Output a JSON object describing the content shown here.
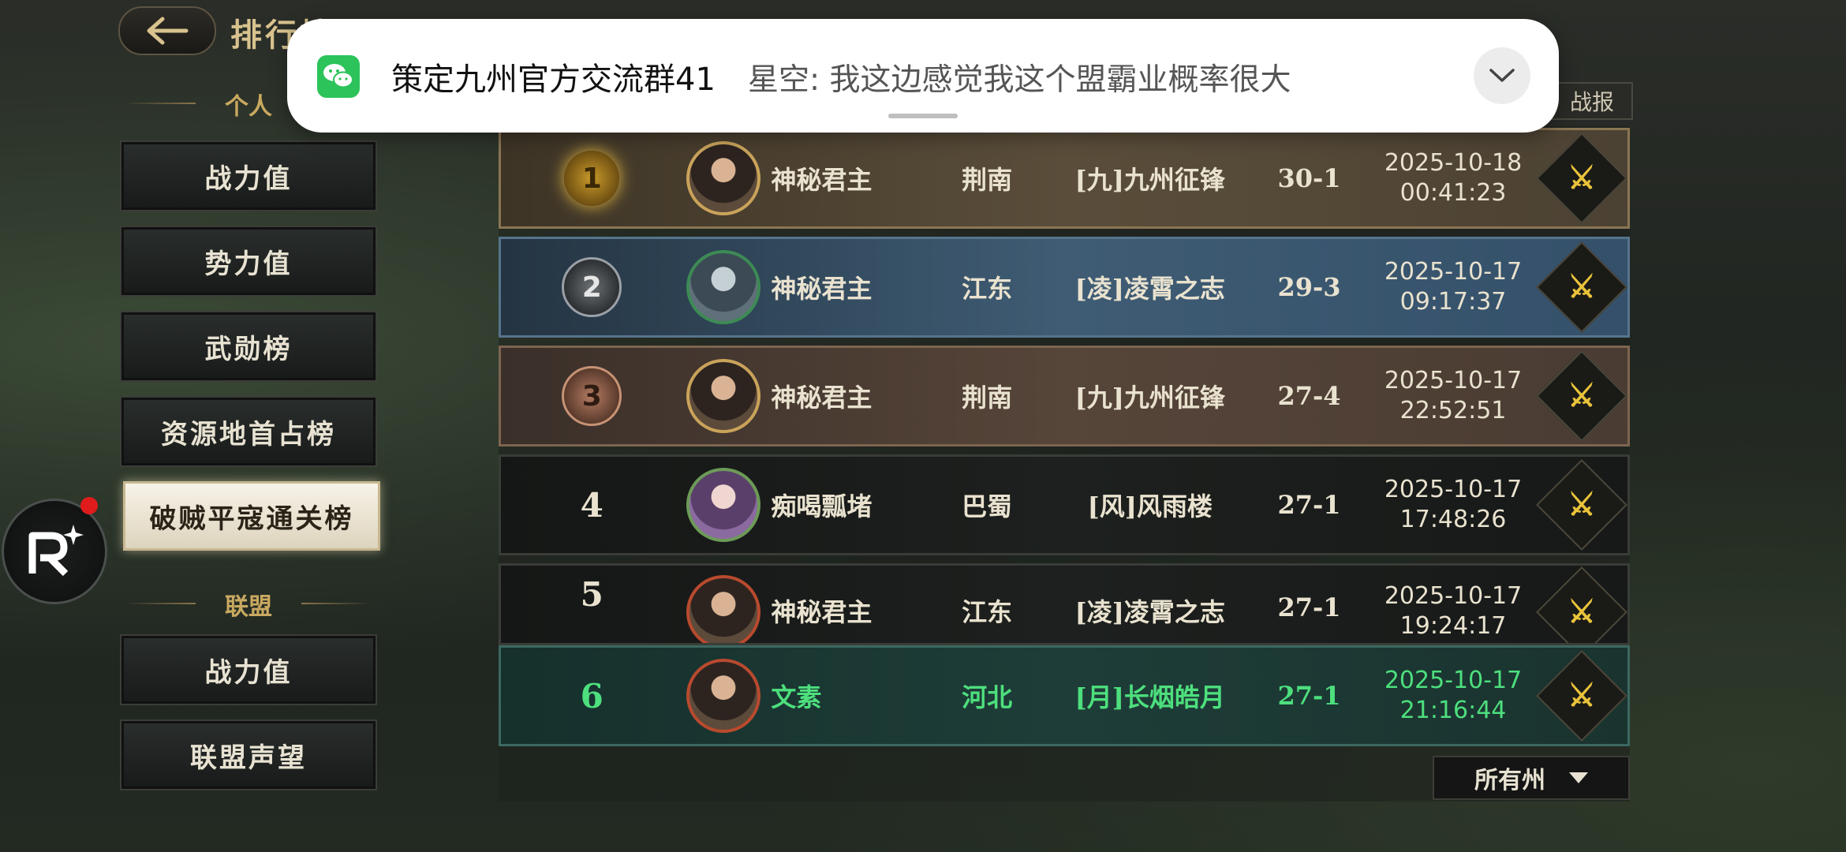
{
  "header": {
    "title": "排行榜"
  },
  "sidebar": {
    "personal_label": "个人",
    "personal_items": [
      "战力值",
      "势力值",
      "武勋榜",
      "资源地首占榜",
      "破贼平寇通关榜"
    ],
    "alliance_label": "联盟",
    "alliance_items": [
      "战力值",
      "联盟声望"
    ]
  },
  "battle_report_tab": "战报",
  "notification": {
    "title": "策定九州官方交流群41",
    "message": "星空: 我这边感觉我这个盟霸业概率很大"
  },
  "rows": [
    {
      "rank": "1",
      "name": "神秘君主",
      "region": "荆南",
      "alliance": "[九]九州征锋",
      "score": "30-1",
      "date": "2025-10-18",
      "time": "00:41:23"
    },
    {
      "rank": "2",
      "name": "神秘君主",
      "region": "江东",
      "alliance": "[凌]凌霄之志",
      "score": "29-3",
      "date": "2025-10-17",
      "time": "09:17:37"
    },
    {
      "rank": "3",
      "name": "神秘君主",
      "region": "荆南",
      "alliance": "[九]九州征锋",
      "score": "27-4",
      "date": "2025-10-17",
      "time": "22:52:51"
    },
    {
      "rank": "4",
      "name": "痴喝瓢堵",
      "region": "巴蜀",
      "alliance": "[风]风雨楼",
      "score": "27-1",
      "date": "2025-10-17",
      "time": "17:48:26"
    },
    {
      "rank": "5",
      "name": "神秘君主",
      "region": "江东",
      "alliance": "[凌]凌霄之志",
      "score": "27-1",
      "date": "2025-10-17",
      "time": "19:24:17"
    }
  ],
  "self_row": {
    "rank": "6",
    "name": "文素",
    "region": "河北",
    "alliance": "[月]长烟皓月",
    "score": "27-1",
    "date": "2025-10-17",
    "time": "21:16:44"
  },
  "filter": {
    "selected": "所有州"
  },
  "colors": {
    "self_highlight": "#4ddf7d",
    "gold": "#c9a960",
    "notification_app": "#2bc35a"
  }
}
